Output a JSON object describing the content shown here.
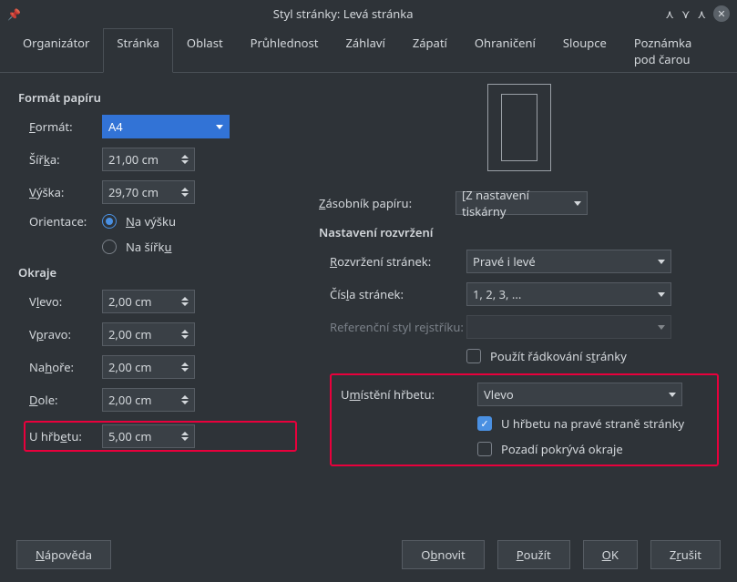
{
  "window": {
    "title": "Styl stránky: Levá stránka"
  },
  "tabs": [
    "Organizátor",
    "Stránka",
    "Oblast",
    "Průhlednost",
    "Záhlaví",
    "Zápatí",
    "Ohraničení",
    "Sloupce",
    "Poznámka pod čarou"
  ],
  "active_tab": 1,
  "paper": {
    "section": "Formát papíru",
    "format_label": "Formát:",
    "format_value": "A4",
    "width_label": "Šířka:",
    "width_value": "21,00 cm",
    "height_label": "Výška:",
    "height_value": "29,70 cm",
    "orientation_label": "Orientace:",
    "portrait": "Na výšku",
    "landscape": "Na šířku",
    "tray_label": "Zásobník papíru:",
    "tray_value": "[Z nastavení tiskárny"
  },
  "margins": {
    "section": "Okraje",
    "left_label": "Vlevo:",
    "left_value": "2,00 cm",
    "right_label": "Vpravo:",
    "right_value": "2,00 cm",
    "top_label": "Nahoře:",
    "top_value": "2,00 cm",
    "bottom_label": "Dole:",
    "bottom_value": "2,00 cm",
    "gutter_label": "U hřbetu:",
    "gutter_value": "5,00 cm"
  },
  "layout": {
    "section": "Nastavení rozvržení",
    "pagelayout_label": "Rozvržení stránek:",
    "pagelayout_value": "Pravé i levé",
    "pagenum_label": "Čísla stránek:",
    "pagenum_value": "1, 2, 3, ...",
    "refstyle_label": "Referenční styl rejstříku:",
    "refstyle_value": "",
    "useline_label": "Použít řádkování stránky",
    "gutterpos_label": "Umístění hřbetu:",
    "gutterpos_value": "Vlevo",
    "gutterright_label": "U hřbetu na pravé straně stránky",
    "bgcovers_label": "Pozadí pokrývá okraje"
  },
  "buttons": {
    "help": "Nápověda",
    "reset": "Obnovit",
    "apply": "Použít",
    "ok": "OK",
    "cancel": "Zrušit"
  }
}
